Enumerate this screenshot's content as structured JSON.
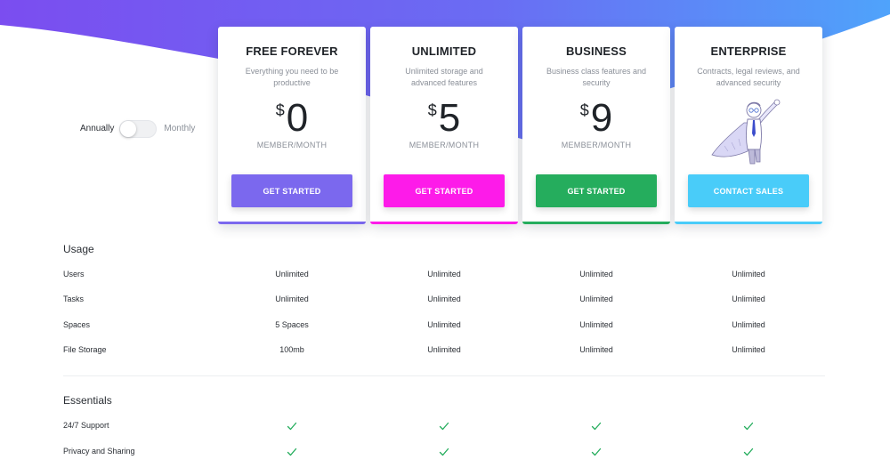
{
  "billing": {
    "annual_label": "Annually",
    "monthly_label": "Monthly"
  },
  "plans": [
    {
      "name": "FREE FOREVER",
      "description": "Everything you need to be productive",
      "currency": "$",
      "price": "0",
      "unit": "MEMBER/MONTH",
      "cta": "GET STARTED",
      "color": "#7b68ee"
    },
    {
      "name": "UNLIMITED",
      "description": "Unlimited storage and advanced features",
      "currency": "$",
      "price": "5",
      "unit": "MEMBER/MONTH",
      "cta": "GET STARTED",
      "color": "#fd1be9"
    },
    {
      "name": "BUSINESS",
      "description": "Business class features and security",
      "currency": "$",
      "price": "9",
      "unit": "MEMBER/MONTH",
      "cta": "GET STARTED",
      "color": "#25ad5d"
    },
    {
      "name": "ENTERPRISE",
      "description": "Contracts, legal reviews, and advanced security",
      "cta": "CONTACT SALES",
      "color": "#49ccf9"
    }
  ],
  "sections": [
    {
      "title": "Usage",
      "rows": [
        {
          "label": "Users",
          "values": [
            "Unlimited",
            "Unlimited",
            "Unlimited",
            "Unlimited"
          ]
        },
        {
          "label": "Tasks",
          "values": [
            "Unlimited",
            "Unlimited",
            "Unlimited",
            "Unlimited"
          ]
        },
        {
          "label": "Spaces",
          "values": [
            "5 Spaces",
            "Unlimited",
            "Unlimited",
            "Unlimited"
          ]
        },
        {
          "label": "File Storage",
          "values": [
            "100mb",
            "Unlimited",
            "Unlimited",
            "Unlimited"
          ]
        }
      ]
    },
    {
      "title": "Essentials",
      "rows": [
        {
          "label": "24/7 Support",
          "values": [
            "check-icon",
            "check-icon",
            "check-icon",
            "check-icon"
          ]
        },
        {
          "label": "Privacy and Sharing",
          "values": [
            "check-icon",
            "check-icon",
            "check-icon",
            "check-icon"
          ]
        }
      ]
    }
  ],
  "colors": {
    "hero_gradient_start": "#7b4df0",
    "hero_gradient_end": "#4fa3fb",
    "check": "#25ad5d"
  }
}
